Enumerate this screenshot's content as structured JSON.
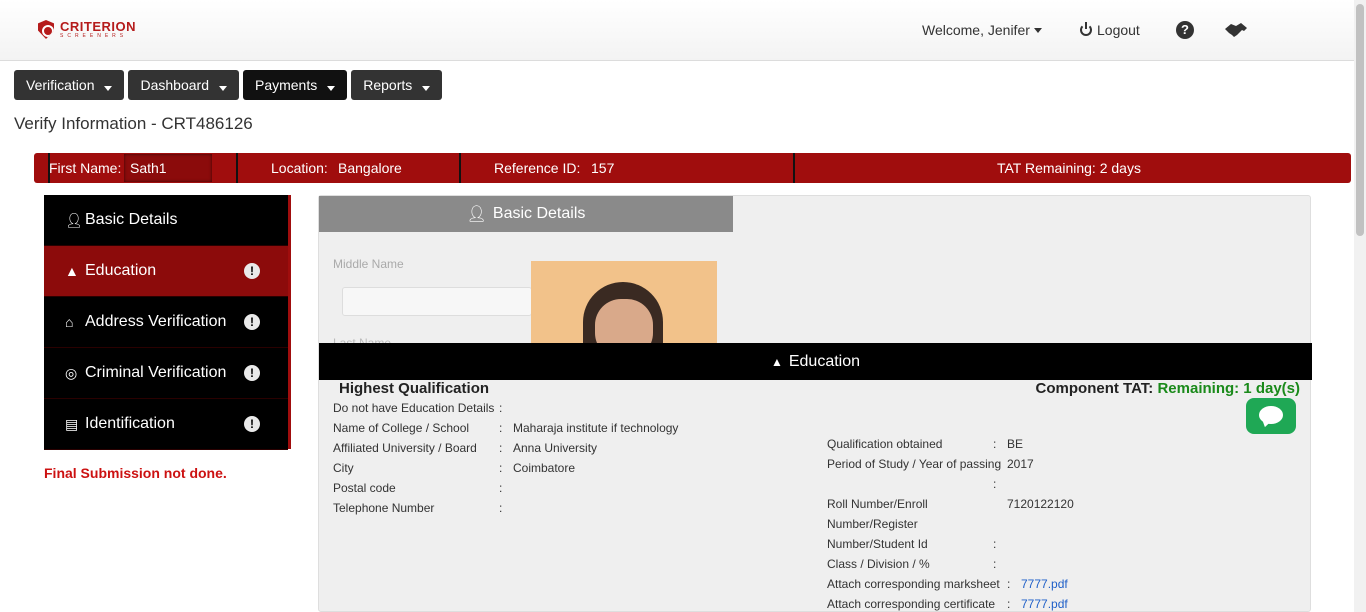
{
  "brand": {
    "name": "CRITERION",
    "tagline": "SCREENERS",
    "color": "#b51c1c"
  },
  "header": {
    "welcome": "Welcome, Jenifer",
    "logout": "Logout",
    "help_icon": "question-circle-icon",
    "handshake_icon": "handshake-icon"
  },
  "nav": {
    "items": [
      {
        "label": "Verification"
      },
      {
        "label": "Dashboard"
      },
      {
        "label": "Payments"
      },
      {
        "label": "Reports"
      }
    ]
  },
  "page": {
    "title": "Verify Information - CRT486126"
  },
  "infobar": {
    "first_name_label": "First Name:",
    "first_name_value": "Sath1",
    "location_label": "Location:",
    "location_value": "Bangalore",
    "reference_label": "Reference ID:",
    "reference_value": "157",
    "tat": "TAT Remaining: 2 days",
    "color": "#a00d0d"
  },
  "sidebar": {
    "items": [
      {
        "label": "Basic Details",
        "icon": "user-icon",
        "warning": false
      },
      {
        "label": "Education",
        "icon": "graduation-cap-icon",
        "warning": true
      },
      {
        "label": "Address Verification",
        "icon": "home-icon",
        "warning": true
      },
      {
        "label": "Criminal Verification",
        "icon": "fingerprint-icon",
        "warning": true
      },
      {
        "label": "Identification",
        "icon": "id-card-icon",
        "warning": true
      }
    ],
    "warning_glyph": "!"
  },
  "final_submission": "Final Submission not done.",
  "basic_details": {
    "header": "Basic Details",
    "middle_name_label": "Middle Name",
    "last_name_label": "Last Name"
  },
  "education": {
    "header": "Education",
    "section_title": "Highest Qualification",
    "component_tat_label": "Component TAT:",
    "component_tat_value": "Remaining: 1 day(s)",
    "left_fields": [
      {
        "label": "Do not have Education Details",
        "value": ""
      },
      {
        "label": "Name of College / School",
        "value": "Maharaja institute if technology"
      },
      {
        "label": "Affiliated University / Board",
        "value": "Anna University"
      },
      {
        "label": "City",
        "value": "Coimbatore"
      },
      {
        "label": "Postal code",
        "value": ""
      },
      {
        "label": "Telephone Number",
        "value": ""
      }
    ],
    "right_fields": {
      "qualification_label": "Qualification obtained",
      "qualification_value": "BE",
      "period_label": "Period of Study / Year of passing",
      "period_value": "2017",
      "roll_label_1": "Roll Number/Enroll",
      "roll_label_2": "Number/Register",
      "roll_label_3": "Number/Student Id",
      "roll_value": "7120122120",
      "class_label": "Class / Division / %",
      "class_value": "",
      "marksheet_label": "Attach corresponding marksheet",
      "marksheet_value": "7777.pdf",
      "certificate_label": "Attach corresponding certificate",
      "certificate_value": "7777.pdf"
    },
    "colon": ":"
  },
  "chat_icon": "chat-bubble-icon"
}
